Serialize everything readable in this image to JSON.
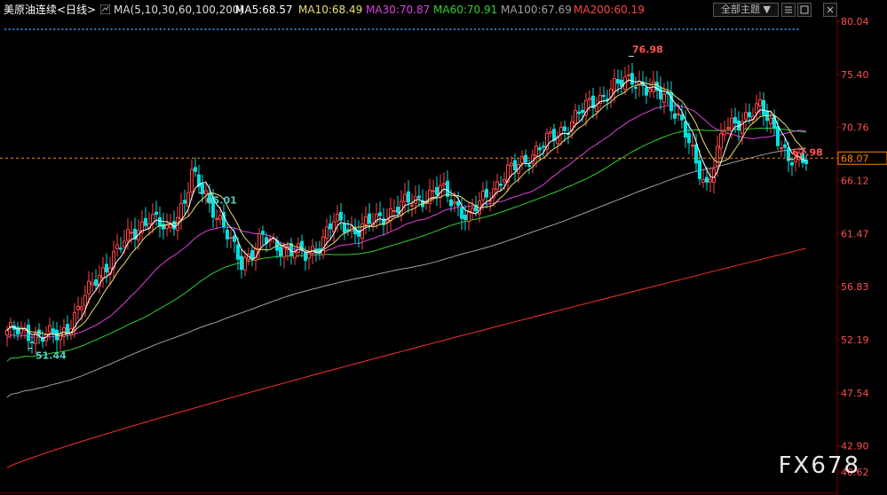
{
  "header": {
    "instrument": "美原油连续<日线>",
    "ma_params": "MA(5,10,30,60,100,200)",
    "ma5": "MA5:68.57",
    "ma10": "MA10:68.49",
    "ma30": "MA30:70.87",
    "ma60": "MA60:70.91",
    "ma100": "MA100:67.69",
    "ma200": "MA200:60.19",
    "theme_button": "全部主题",
    "theme_arrow": "▼",
    "icon_names": [
      "chart-type-icon",
      "list-icon",
      "window-icon",
      "close-icon"
    ]
  },
  "colors": {
    "up": "#ff4444",
    "down": "#00e0e0",
    "ma5": "#ffffff",
    "ma10": "#e8e070",
    "ma30": "#e040e0",
    "ma60": "#30d030",
    "ma100": "#a0a0a0",
    "ma200": "#ff3030",
    "axis_text": "#ff4d4d",
    "current_line": "#ff8800"
  },
  "watermark": "FX678",
  "chart_data": {
    "type": "candlestick",
    "ylim": [
      40.62,
      80.04
    ],
    "y_ticks": [
      "80.04",
      "75.40",
      "70.76",
      "66.12",
      "61.47",
      "56.83",
      "52.19",
      "47.54",
      "42.90",
      "40.62"
    ],
    "current_price": "68.07",
    "annotations": [
      {
        "label": "76.98",
        "value": 76.98,
        "type": "high"
      },
      {
        "label": "67.98",
        "value": 67.98,
        "type": "high"
      },
      {
        "label": "65.01",
        "value": 65.01,
        "type": "low"
      },
      {
        "label": "51.44",
        "value": 51.44,
        "type": "low"
      }
    ],
    "close_anchors": [
      [
        0,
        53.0
      ],
      [
        8,
        52.6
      ],
      [
        15,
        52.5
      ],
      [
        20,
        54.8
      ],
      [
        25,
        57.5
      ],
      [
        30,
        59.5
      ],
      [
        35,
        61.5
      ],
      [
        40,
        62.8
      ],
      [
        45,
        61.8
      ],
      [
        50,
        64.2
      ],
      [
        52,
        66.5
      ],
      [
        56,
        65.0
      ],
      [
        62,
        61.2
      ],
      [
        66,
        59.0
      ],
      [
        72,
        61.0
      ],
      [
        78,
        60.2
      ],
      [
        84,
        59.5
      ],
      [
        88,
        60.6
      ],
      [
        92,
        62.5
      ],
      [
        98,
        61.8
      ],
      [
        104,
        62.6
      ],
      [
        110,
        63.8
      ],
      [
        116,
        64.5
      ],
      [
        122,
        65.3
      ],
      [
        126,
        64.2
      ],
      [
        130,
        62.8
      ],
      [
        134,
        64.5
      ],
      [
        140,
        66.5
      ],
      [
        146,
        68.0
      ],
      [
        152,
        69.5
      ],
      [
        158,
        71.0
      ],
      [
        164,
        72.8
      ],
      [
        170,
        74.0
      ],
      [
        176,
        75.2
      ],
      [
        180,
        74.0
      ],
      [
        186,
        73.5
      ],
      [
        190,
        71.0
      ],
      [
        194,
        67.5
      ],
      [
        197,
        65.8
      ],
      [
        202,
        70.5
      ],
      [
        208,
        71.8
      ],
      [
        212,
        72.4
      ],
      [
        216,
        70.8
      ],
      [
        220,
        67.8
      ],
      [
        222,
        67.6
      ],
      [
        225,
        68.1
      ]
    ],
    "ma200_range": [
      41.0,
      60.19
    ],
    "ma100_range": [
      44.0,
      67.69
    ],
    "ma60_range": [
      47.0,
      70.91
    ],
    "ma30_range": [
      49.5,
      70.87
    ],
    "ma10_end": 68.49,
    "ma5_end": 68.57
  }
}
